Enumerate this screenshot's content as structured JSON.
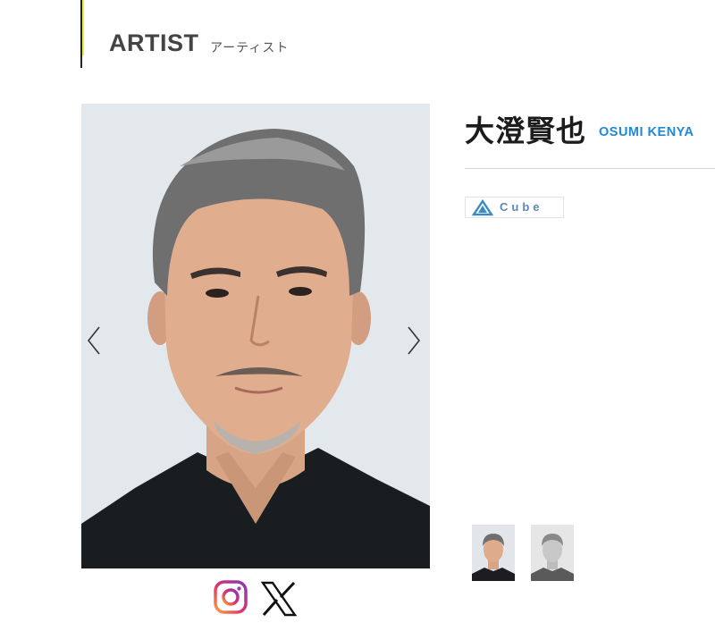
{
  "section": {
    "title": "ARTIST",
    "subtitle": "アーティスト"
  },
  "artist": {
    "name_jp": "大澄賢也",
    "name_en": "OSUMI KENYA",
    "agency_label": "Cube",
    "agency_icon": "cube-logo-icon"
  },
  "gallery": {
    "main_photo": "artist-portrait",
    "prev_icon": "chevron-left-icon",
    "next_icon": "chevron-right-icon",
    "thumbnails": [
      "thumbnail-photo-1",
      "thumbnail-photo-2"
    ]
  },
  "social": {
    "links": [
      "instagram-icon",
      "x-icon"
    ]
  },
  "colors": {
    "accent_blue": "#1e8ad6",
    "header_accent": "#f2ee3a",
    "background": "#ffffff",
    "photo_bg": "#e3e8ec"
  }
}
